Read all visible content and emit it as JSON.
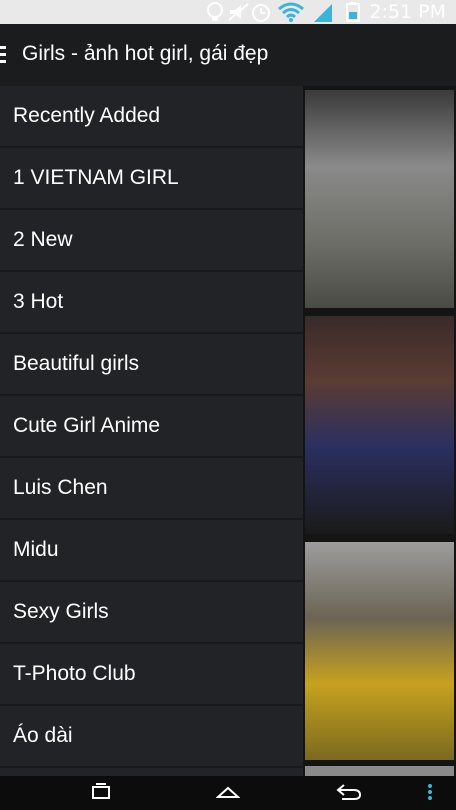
{
  "status_bar": {
    "time": "2:51 PM",
    "icons": [
      "bulb-icon",
      "mute-icon",
      "alarm-icon",
      "wifi-icon",
      "signal-icon",
      "battery-icon"
    ]
  },
  "action_bar": {
    "title": "Girls - ảnh hot girl, gái đẹp",
    "menu_icon": "hamburger-menu-icon"
  },
  "drawer": {
    "items": [
      "Recently Added",
      "1 VIETNAM GIRL",
      "2 New",
      "3 Hot",
      "Beautiful girls",
      "Cute Girl Anime",
      "Luis Chen",
      "Midu",
      "Sexy Girls",
      "T-Photo Club",
      "Áo dài"
    ]
  },
  "nav_bar": {
    "buttons": [
      "recent-apps-icon",
      "home-icon",
      "back-icon",
      "overflow-menu-icon"
    ]
  },
  "colors": {
    "drawer_bg": "#222326",
    "action_bar_bg": "#1b1c1e",
    "status_icon": "#3cb4d9"
  }
}
